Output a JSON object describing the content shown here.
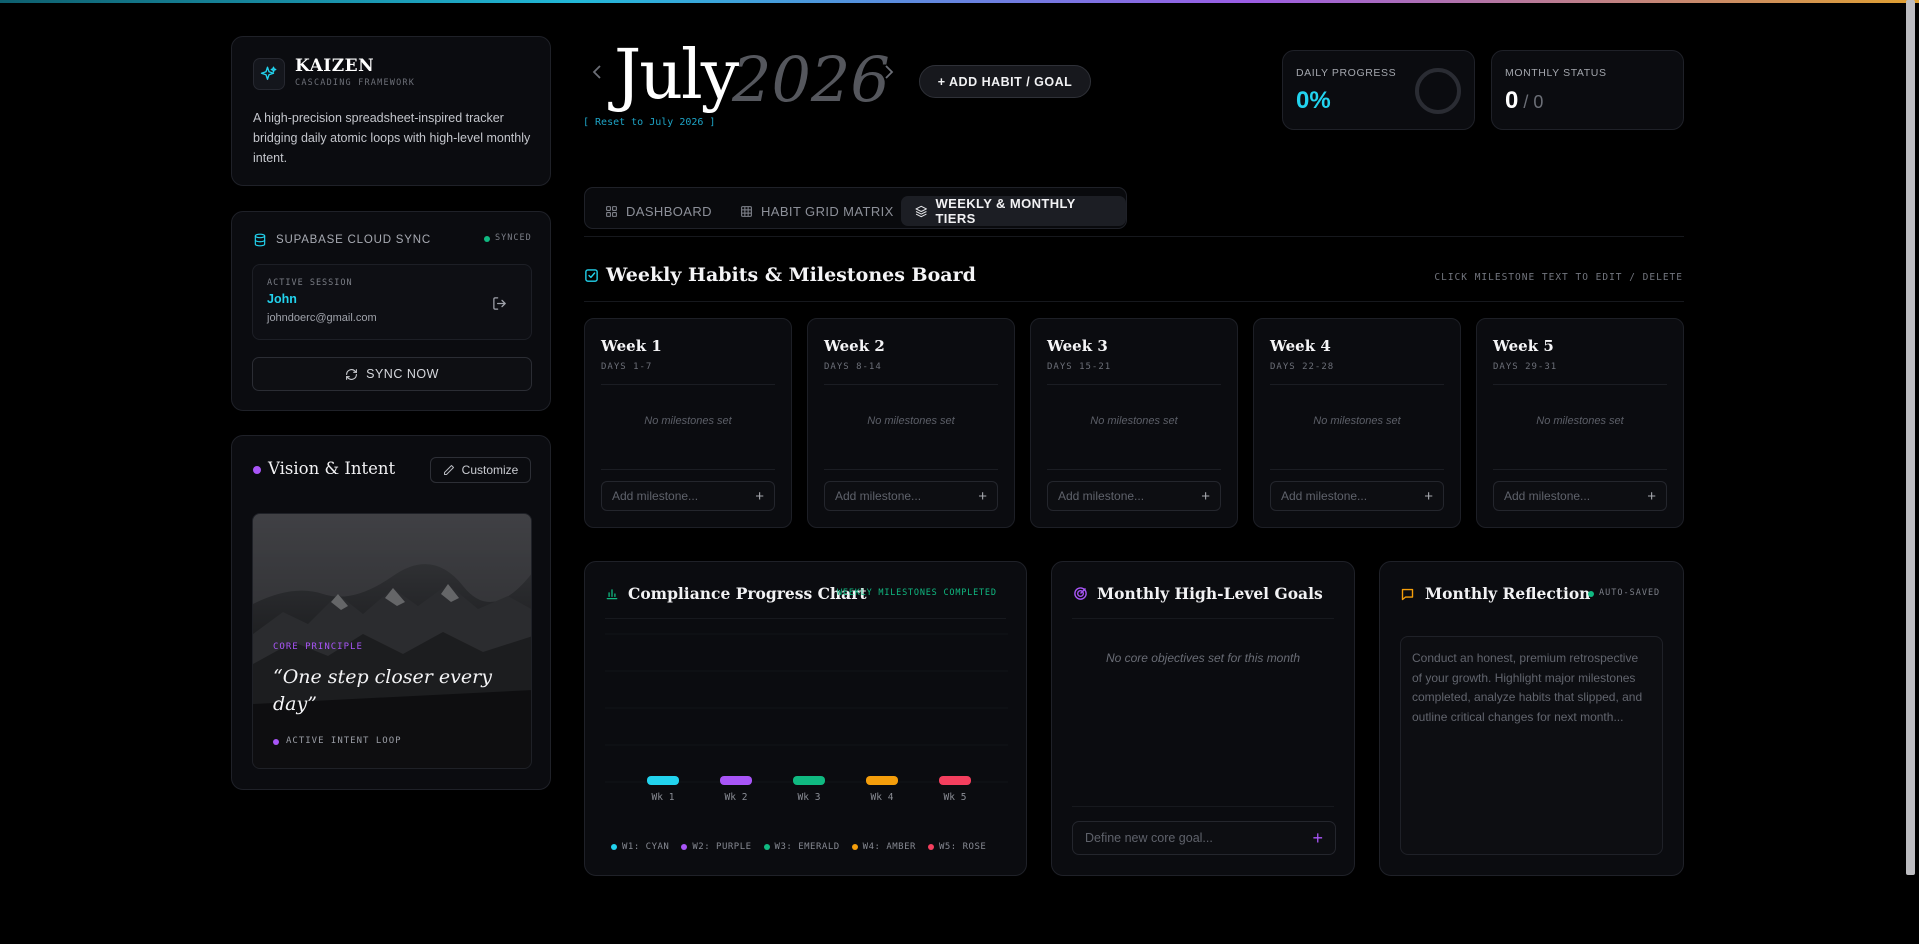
{
  "app": {
    "name": "KAIZEN",
    "tagline": "CASCADING FRAMEWORK",
    "description": "A high-precision spreadsheet-inspired tracker bridging daily atomic loops with high-level monthly intent."
  },
  "sync": {
    "title": "SUPABASE CLOUD SYNC",
    "status": "SYNCED",
    "session_label": "ACTIVE SESSION",
    "user_name": "John",
    "user_email": "johndoerc@gmail.com",
    "sync_button": "SYNC NOW"
  },
  "vision": {
    "title": "Vision & Intent",
    "customize_label": "Customize",
    "principle_label": "CORE PRINCIPLE",
    "quote": "“One step closer every day”",
    "loop_label": "ACTIVE INTENT LOOP"
  },
  "header": {
    "month": "July",
    "year": "2026",
    "reset_link": "[ Reset to July 2026 ]",
    "add_button": "+ ADD HABIT / GOAL"
  },
  "stats": {
    "daily_label": "DAILY PROGRESS",
    "daily_value": "0%",
    "daily_progress": 0,
    "monthly_label": "MONTHLY STATUS",
    "monthly_done": "0",
    "monthly_total": "/ 0"
  },
  "tabs": [
    {
      "label": "DASHBOARD",
      "active": false
    },
    {
      "label": "HABIT GRID MATRIX",
      "active": false
    },
    {
      "label": "WEEKLY & MONTHLY TIERS",
      "active": true
    }
  ],
  "board": {
    "title": "Weekly Habits & Milestones Board",
    "hint": "CLICK MILESTONE TEXT TO EDIT / DELETE"
  },
  "weeks": [
    {
      "title": "Week 1",
      "days": "DAYS 1-7",
      "empty": "No milestones set",
      "placeholder": "Add milestone..."
    },
    {
      "title": "Week 2",
      "days": "DAYS 8-14",
      "empty": "No milestones set",
      "placeholder": "Add milestone..."
    },
    {
      "title": "Week 3",
      "days": "DAYS 15-21",
      "empty": "No milestones set",
      "placeholder": "Add milestone..."
    },
    {
      "title": "Week 4",
      "days": "DAYS 22-28",
      "empty": "No milestones set",
      "placeholder": "Add milestone..."
    },
    {
      "title": "Week 5",
      "days": "DAYS 29-31",
      "empty": "No milestones set",
      "placeholder": "Add milestone..."
    }
  ],
  "compliance": {
    "title": "Compliance Progress Chart",
    "badge": "WEEKLY MILESTONES COMPLETED"
  },
  "chart_data": {
    "type": "bar",
    "title": "Compliance Progress Chart",
    "subtitle": "WEEKLY MILESTONES COMPLETED",
    "categories": [
      "Wk 1",
      "Wk 2",
      "Wk 3",
      "Wk 4",
      "Wk 5"
    ],
    "values": [
      0,
      0,
      0,
      0,
      0
    ],
    "colors": [
      "#22d3ee",
      "#a855f7",
      "#10b981",
      "#f59e0b",
      "#f43f5e"
    ],
    "legend": [
      "W1: CYAN",
      "W2: PURPLE",
      "W3: EMERALD",
      "W4: AMBER",
      "W5: ROSE"
    ],
    "legend_position": "bottom",
    "grid": true
  },
  "goals": {
    "title": "Monthly High-Level Goals",
    "empty": "No core objectives set for this month",
    "placeholder": "Define new core goal..."
  },
  "reflection": {
    "title": "Monthly Reflection",
    "status": "AUTO-SAVED",
    "placeholder": "Conduct an honest, premium retrospective of your growth. Highlight major milestones completed, analyze habits that slipped, and outline critical changes for next month..."
  },
  "colors": {
    "accent_cyan": "#22d3ee",
    "accent_purple": "#a855f7",
    "accent_green": "#10b981",
    "accent_amber": "#f59e0b",
    "accent_rose": "#f43f5e",
    "background": "#000000"
  }
}
